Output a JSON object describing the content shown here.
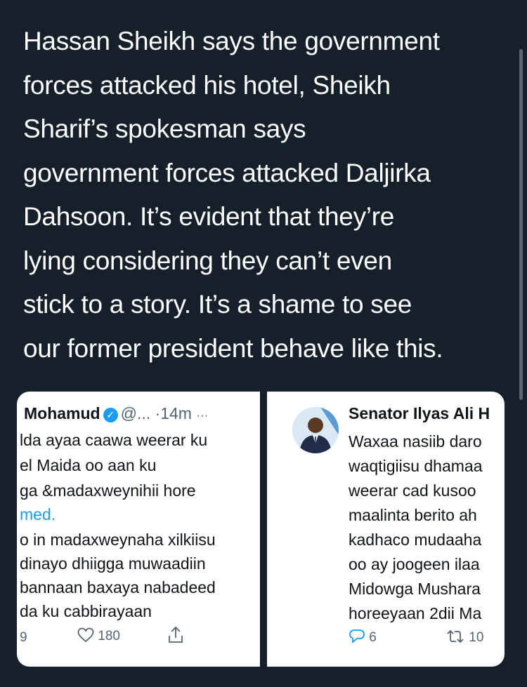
{
  "tweet": {
    "lines": [
      "Hassan Sheikh says the government",
      "forces attacked his hotel, Sheikh",
      "Sharif’s spokesman says",
      "government forces attacked Daljirka",
      "Dahsoon. It’s evident that they’re",
      "lying considering they can’t even",
      "stick to a story. It’s a shame to see",
      "our former president behave like this."
    ]
  },
  "left_shot": {
    "name": "Mohamud",
    "handle": "@...",
    "time": "·14m",
    "more": "···",
    "lines": [
      "lda ayaa caawa weerar ku",
      "el Maida oo aan ku",
      "ga &madaxweynihii hore",
      "med.",
      "o in madaxweynaha xilkiisu",
      "dinayo dhiigga muwaadiin",
      "bannaan baxaya nabadeed",
      "da  ku cabbirayaan"
    ],
    "reply_count": "9",
    "like_count": "180"
  },
  "right_shot": {
    "name": "Senator Ilyas Ali H",
    "lines": [
      "Waxaa nasiib daro",
      "waqtigiisu dhamaa",
      "weerar cad kusoo",
      "maalinta berito ah",
      "kadhaco mudaaha",
      "oo ay joogeen ilaa",
      "Midowga Mushara",
      "horeeyaan 2dii Ma"
    ],
    "reply_count": "6",
    "retweet_count": "10"
  },
  "colors": {
    "background": "#15202b",
    "text": "#ffffff",
    "accent": "#1d9bf0",
    "muted": "#536471"
  }
}
